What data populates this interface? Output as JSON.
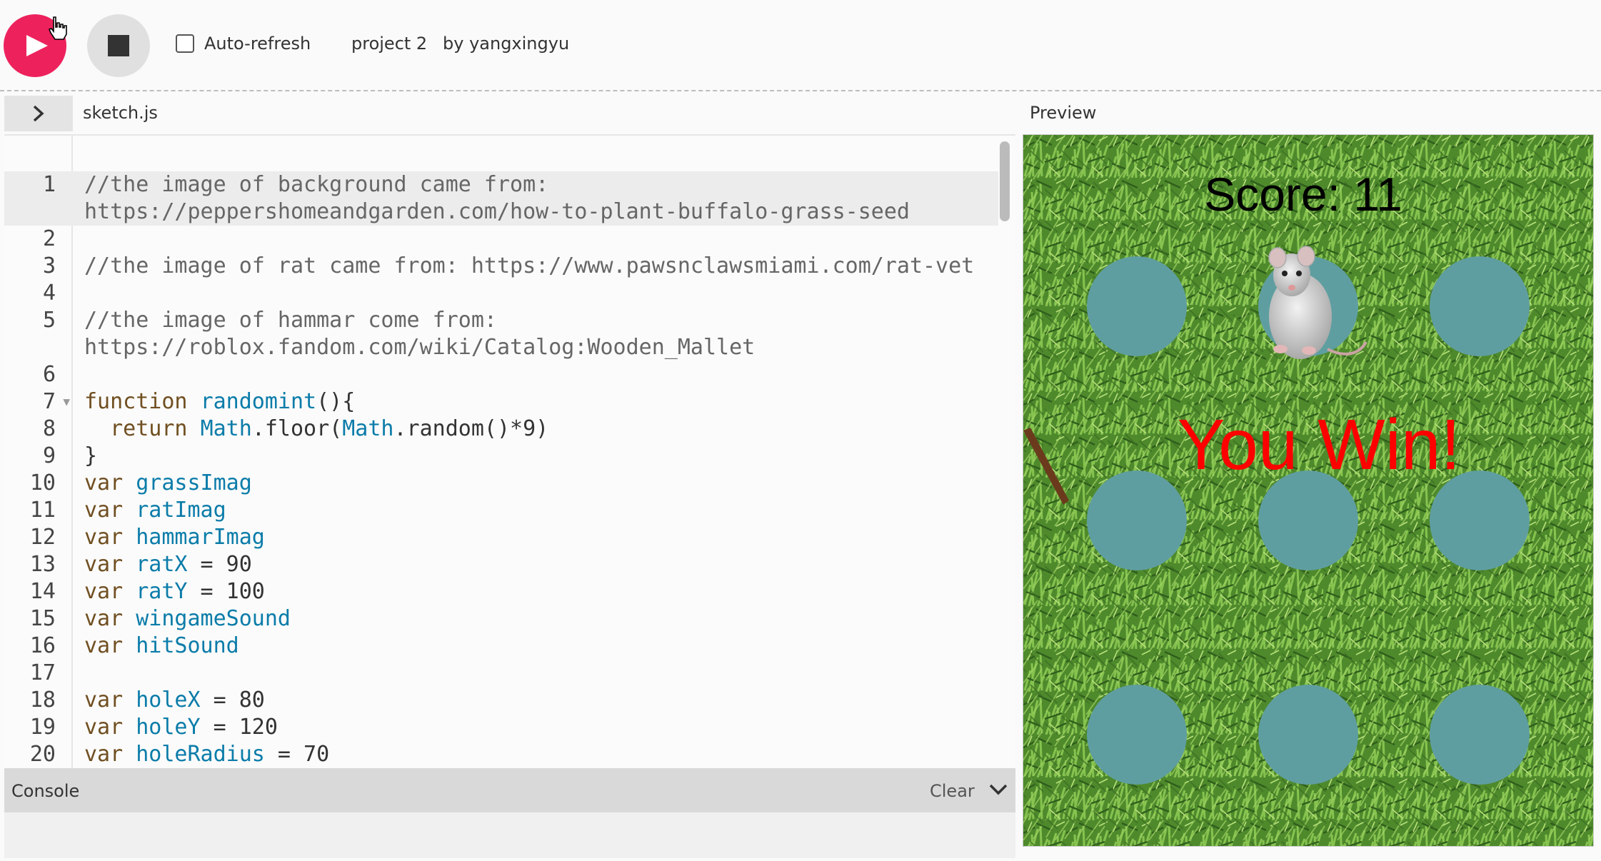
{
  "toolbar": {
    "play_icon": "play-icon",
    "stop_icon": "stop-icon",
    "auto_refresh_label": "Auto-refresh",
    "auto_refresh_checked": false,
    "project_name": "project 2",
    "author": "by yangxingyu",
    "colors": {
      "play": "#ed225d",
      "stop": "#e0e0e0"
    }
  },
  "editor": {
    "toggle_icon": "chevron-right-icon",
    "filename": "sketch.js",
    "lines": [
      {
        "num": "1",
        "text": "//the image of background came from:"
      },
      {
        "num": "",
        "text": "https://peppershomeandgarden.com/how-to-plant-buffalo-grass-seed"
      },
      {
        "num": "2",
        "text": ""
      },
      {
        "num": "3",
        "text": "//the image of rat came from: https://www.pawsnclawsmiami.com/rat-vet"
      },
      {
        "num": "4",
        "text": ""
      },
      {
        "num": "5",
        "text": "//the image of hammar come from:"
      },
      {
        "num": "",
        "text": "https://roblox.fandom.com/wiki/Catalog:Wooden_Mallet"
      },
      {
        "num": "6",
        "text": ""
      },
      {
        "num": "7",
        "text": "function randomint(){"
      },
      {
        "num": "8",
        "text": "  return Math.floor(Math.random()*9)"
      },
      {
        "num": "9",
        "text": "}"
      },
      {
        "num": "10",
        "text": "var grassImag"
      },
      {
        "num": "11",
        "text": "var ratImag"
      },
      {
        "num": "12",
        "text": "var hammarImag"
      },
      {
        "num": "13",
        "text": "var ratX = 90"
      },
      {
        "num": "14",
        "text": "var ratY = 100"
      },
      {
        "num": "15",
        "text": "var wingameSound"
      },
      {
        "num": "16",
        "text": "var hitSound"
      },
      {
        "num": "17",
        "text": ""
      },
      {
        "num": "18",
        "text": "var holeX = 80"
      },
      {
        "num": "19",
        "text": "var holeY = 120"
      },
      {
        "num": "20",
        "text": "var holeRadius = 70"
      }
    ]
  },
  "console": {
    "title": "Console",
    "clear_label": "Clear",
    "collapse_icon": "chevron-down-icon"
  },
  "preview": {
    "label": "Preview",
    "score_text": "Score: 11",
    "win_text": "You Win!",
    "hole_color": "#5f9ea0",
    "win_color": "#ff0000"
  }
}
